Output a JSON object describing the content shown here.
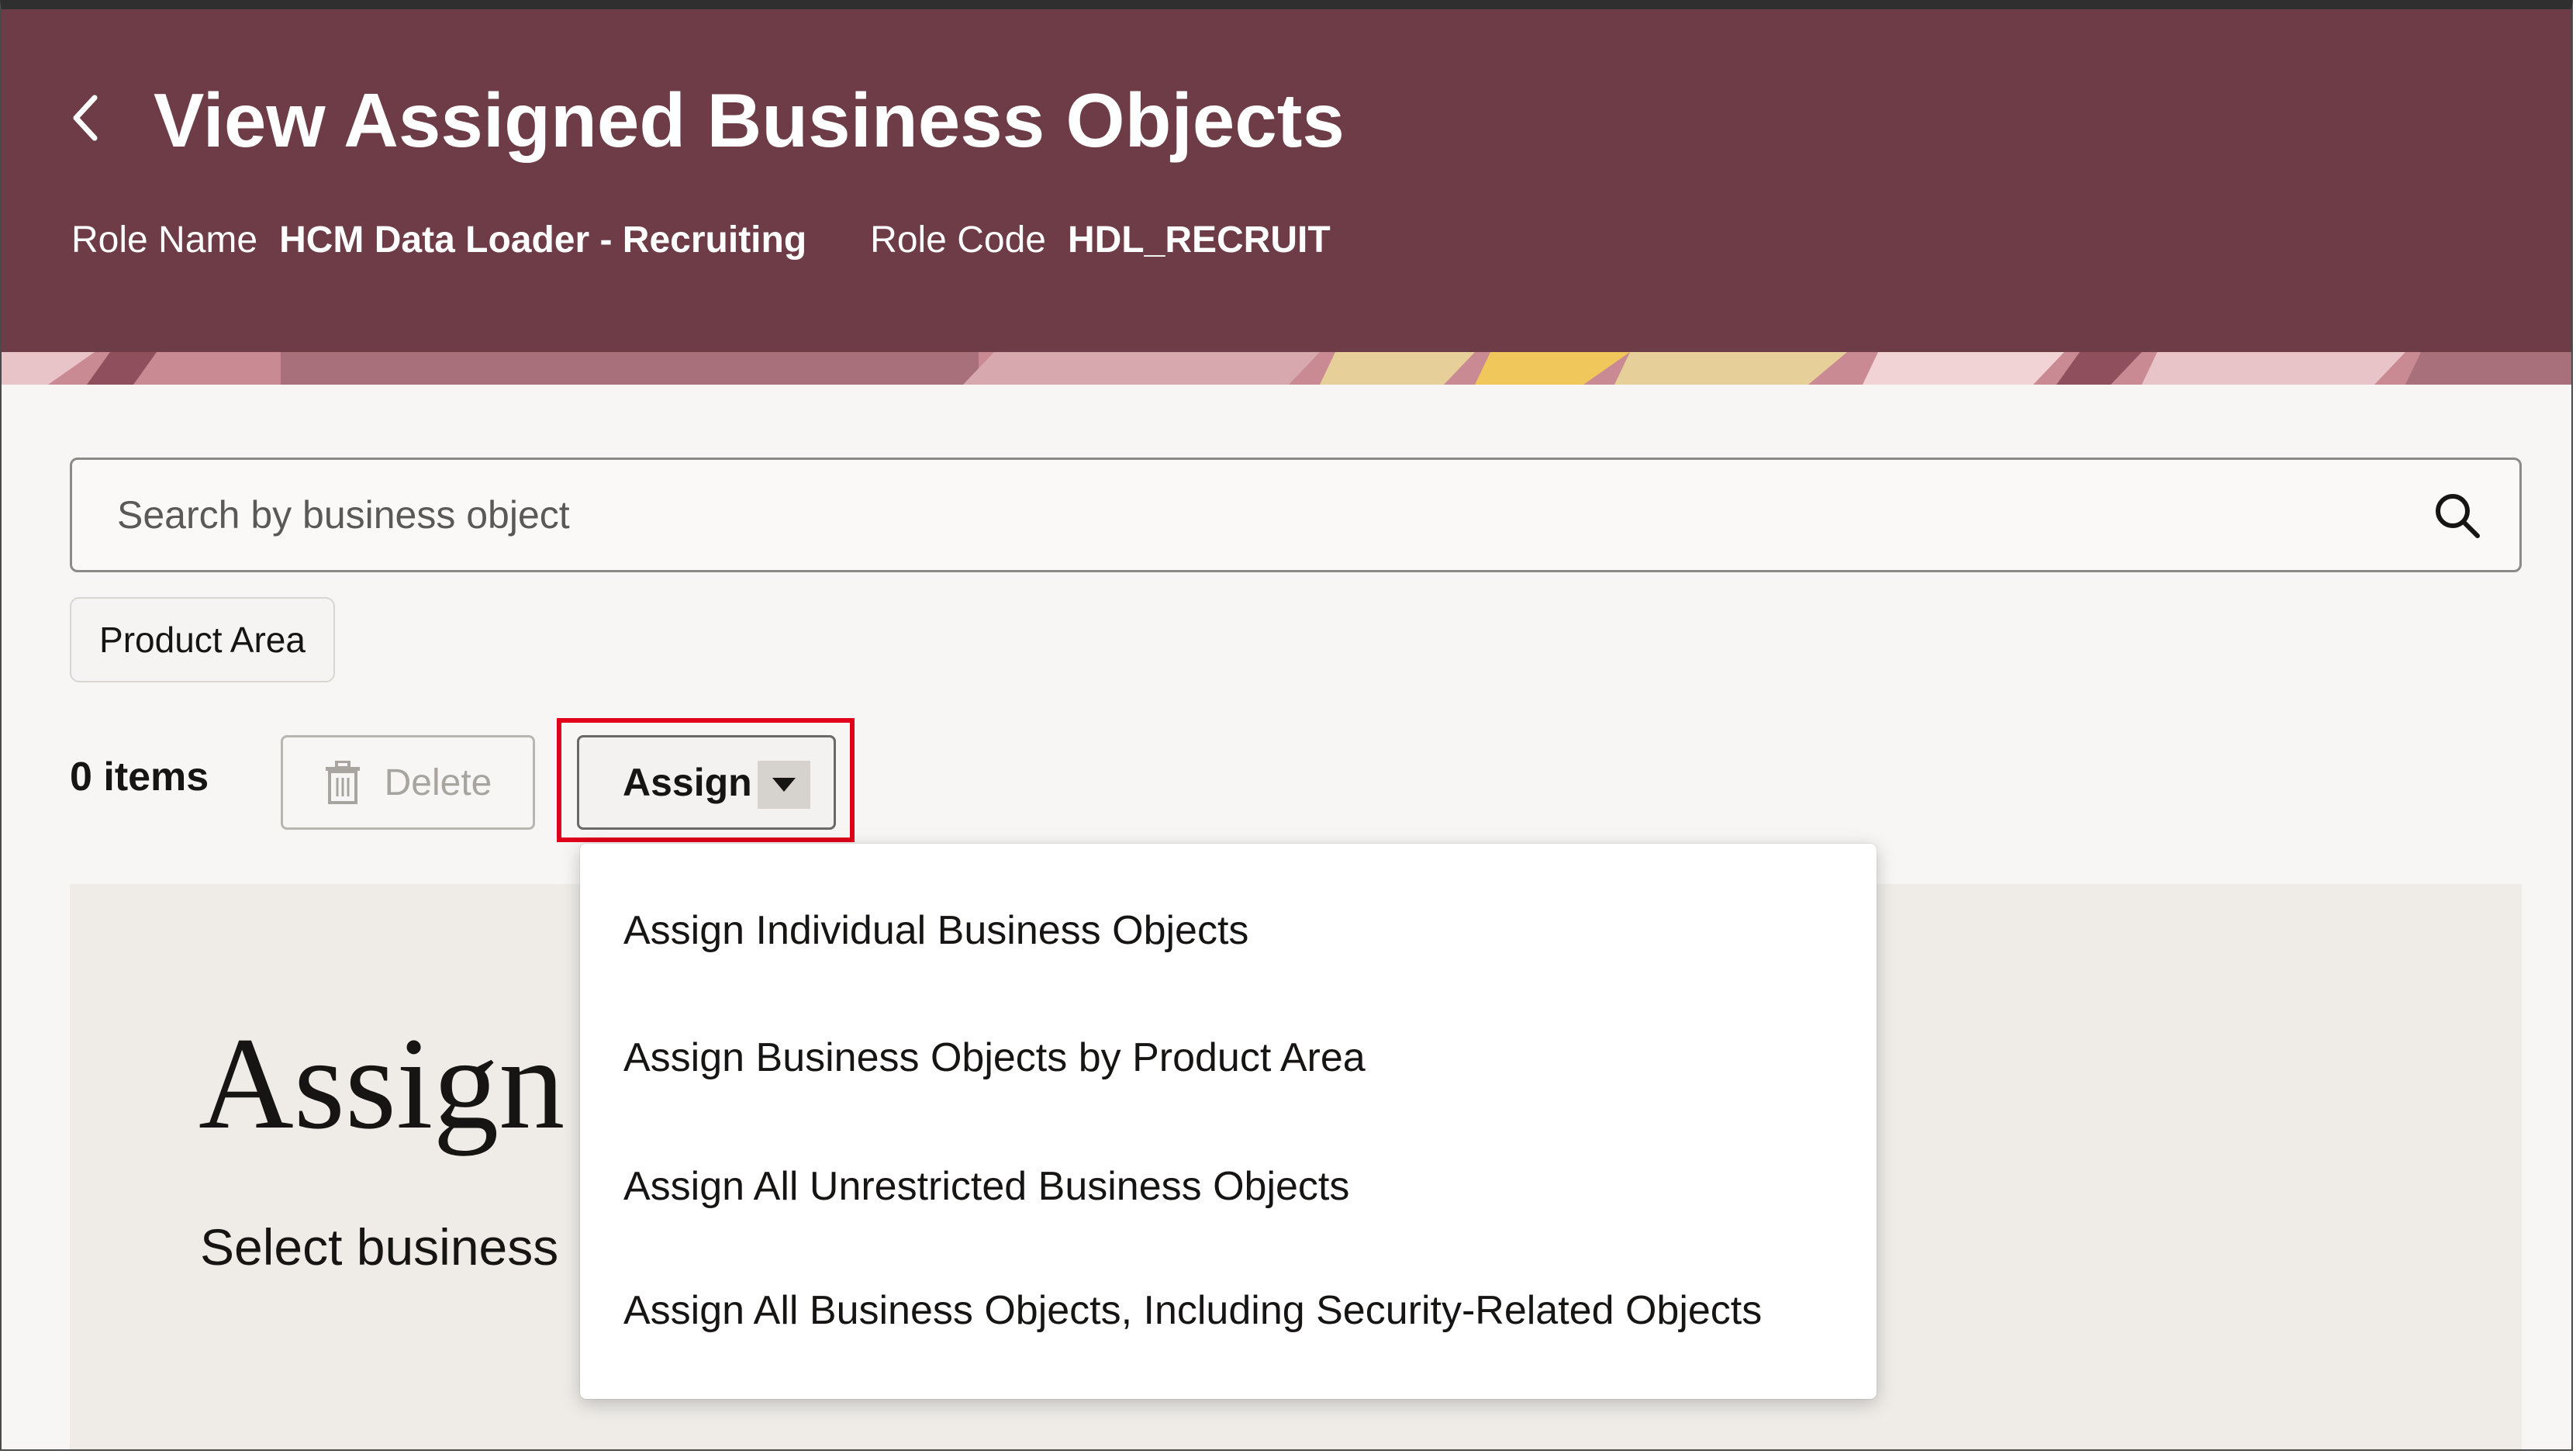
{
  "header": {
    "title": "View Assigned Business Objects",
    "role_name_label": "Role Name",
    "role_name_value": "HCM Data Loader - Recruiting",
    "role_code_label": "Role Code",
    "role_code_value": "HDL_RECRUIT",
    "background_color": "#6d3c47",
    "back_icon": "chevron-left-icon"
  },
  "search": {
    "placeholder": "Search by business object",
    "value": "",
    "icon": "search-icon"
  },
  "filters": {
    "product_area_chip": "Product Area"
  },
  "toolbar": {
    "items_count": "0 items",
    "delete_label": "Delete",
    "delete_icon": "trash-icon",
    "assign_label": "Assign",
    "assign_caret_icon": "caret-down-icon",
    "highlight_color": "#e0001a"
  },
  "assign_menu": {
    "items": [
      {
        "label": "Assign Individual Business Objects"
      },
      {
        "label": "Assign Business Objects by Product Area"
      },
      {
        "label": "Assign All Unrestricted Business Objects"
      },
      {
        "label": "Assign All Business Objects, Including Security-Related Objects"
      }
    ]
  },
  "empty_state": {
    "title": "Assign",
    "subtitle": "Select business"
  }
}
